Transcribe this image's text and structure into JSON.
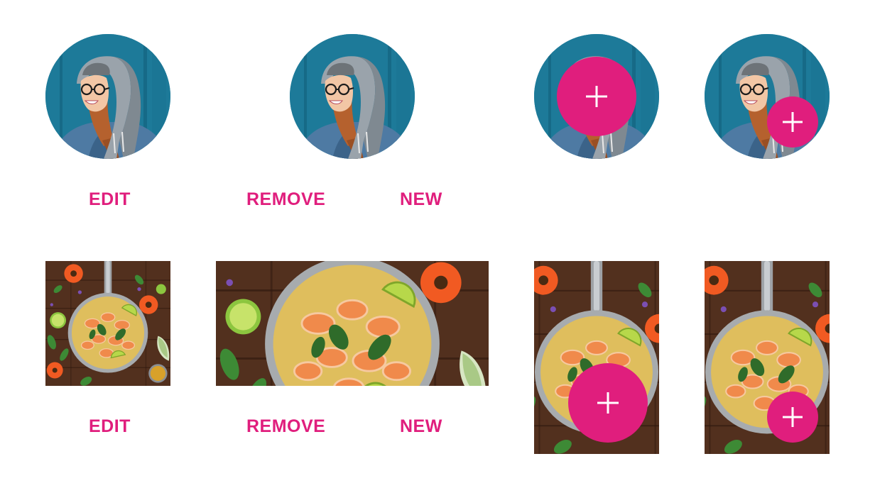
{
  "colors": {
    "accent": "#e01e7d",
    "background": "#ffffff",
    "avatar_backdrop": "#1d7e9d",
    "wood": "#5a3422"
  },
  "icons": {
    "add": "plus-icon"
  },
  "avatar_row": {
    "edit_label": "EDIT",
    "remove_label": "REMOVE",
    "new_label": "NEW"
  },
  "photo_row": {
    "edit_label": "EDIT",
    "remove_label": "REMOVE",
    "new_label": "NEW"
  }
}
